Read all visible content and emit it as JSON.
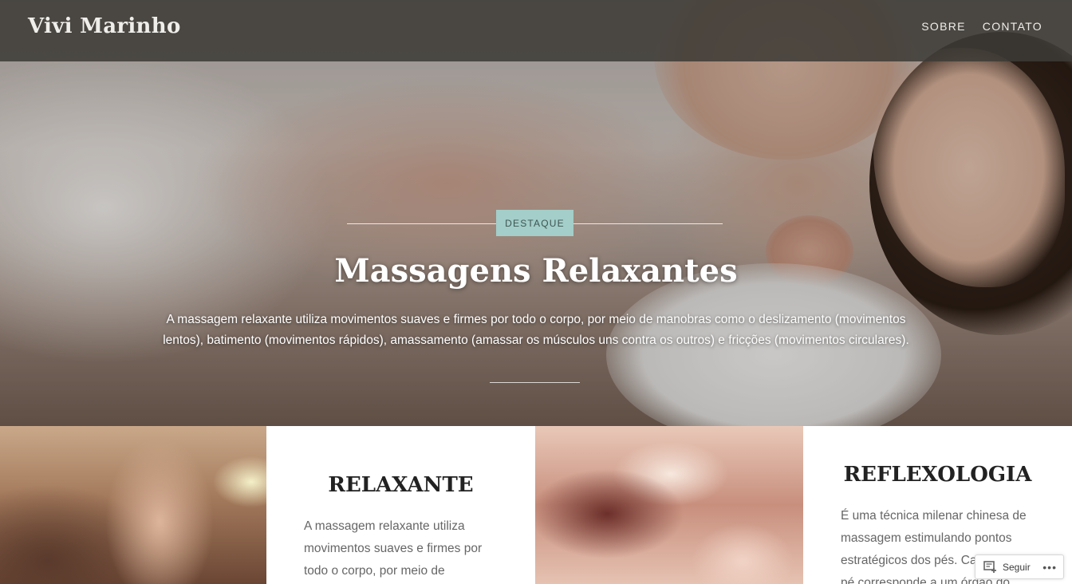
{
  "site": {
    "title": "Vivi Marinho"
  },
  "nav": {
    "items": [
      {
        "label": "SOBRE"
      },
      {
        "label": "CONTATO"
      }
    ]
  },
  "hero": {
    "badge": "DESTAQUE",
    "title": "Massagens Relaxantes",
    "excerpt": "A massagem relaxante utiliza movimentos suaves e firmes por todo o corpo, por meio de manobras como o deslizamento (movimentos lentos), batimento (movimentos rápidos), amassamento (amassar os músculos uns contra os outros) e fricções (movimentos circulares)."
  },
  "posts": [
    {
      "title": "RELAXANTE",
      "excerpt": "A massagem relaxante utiliza movimentos suaves e firmes por todo o corpo, por meio de"
    },
    {
      "title": "REFLEXOLOGIA",
      "excerpt": "É uma técnica milenar chinesa de massagem estimulando pontos estratégicos dos pés. Cada parte do pé corresponde a um órgão do"
    }
  ],
  "follow": {
    "label": "Seguir",
    "more_icon": "ellipsis-icon"
  },
  "colors": {
    "badge_bg": "#a3cec9",
    "header_bg": "#3c3a36",
    "title_text": "#222222",
    "body_text": "#666666"
  }
}
